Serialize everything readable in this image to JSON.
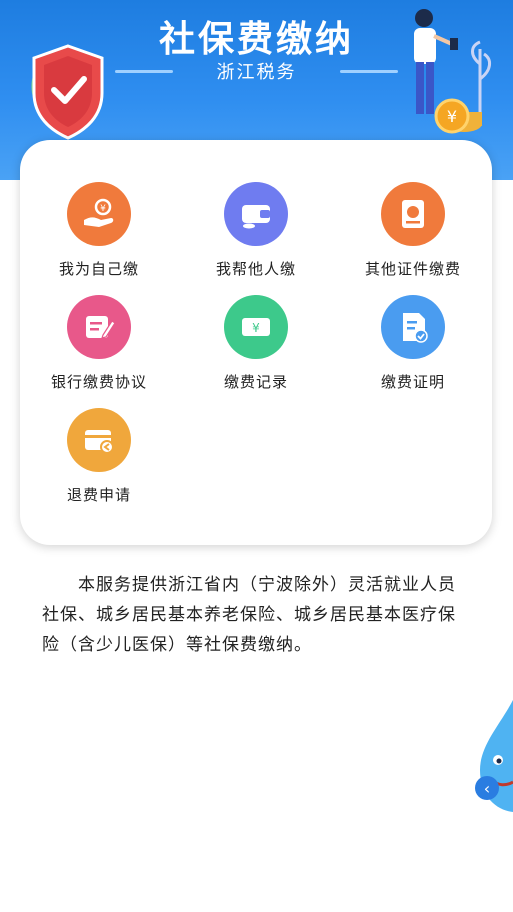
{
  "header": {
    "title": "社保费缴纳",
    "subtitle": "浙江税务"
  },
  "menu": [
    {
      "label": "我为自己缴",
      "icon": "hand-coin-icon",
      "color": "#f07a3c"
    },
    {
      "label": "我帮他人缴",
      "icon": "wallet-icon",
      "color": "#6f7cf0"
    },
    {
      "label": "其他证件缴费",
      "icon": "id-card-icon",
      "color": "#f07a3c"
    },
    {
      "label": "银行缴费协议",
      "icon": "agreement-pen-icon",
      "color": "#e8588a"
    },
    {
      "label": "缴费记录",
      "icon": "yuan-ticket-icon",
      "color": "#3dc98b"
    },
    {
      "label": "缴费证明",
      "icon": "certificate-check-icon",
      "color": "#4a9cf0"
    },
    {
      "label": "退费申请",
      "icon": "refund-card-icon",
      "color": "#f0a73c"
    }
  ],
  "description": "本服务提供浙江省内（宁波除外）灵活就业人员社保、城乡居民基本养老保险、城乡居民基本医疗保险（含少儿医保）等社保费缴纳。",
  "float_button": {
    "icon": "chevron-left-icon",
    "label": "‹"
  }
}
